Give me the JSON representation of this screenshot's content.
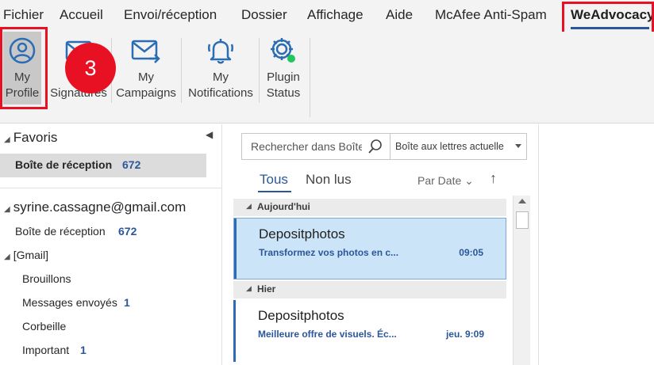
{
  "menu": {
    "tabs": [
      "Fichier",
      "Accueil",
      "Envoi/réception",
      "Dossier",
      "Affichage",
      "Aide",
      "McAfee Anti-Spam",
      "WeAdvocacy"
    ],
    "active": "WeAdvocacy"
  },
  "ribbon": {
    "my_profile": [
      "My",
      "Profile"
    ],
    "signatures": [
      "Signatures"
    ],
    "my_campaigns": [
      "My",
      "Campaigns"
    ],
    "my_notifications": [
      "My",
      "Notifications"
    ],
    "plugin_status": [
      "Plugin",
      "Status"
    ],
    "step_badge": "3",
    "plugin_status_color": "#22c55e",
    "accent": "#2b6cb3",
    "highlight": "#e81123"
  },
  "folders": {
    "favorites_title": "Favoris",
    "fav_inbox": {
      "label": "Boîte de réception",
      "count": "672"
    },
    "account": "syrine.cassagne@gmail.com",
    "items": [
      {
        "label": "Boîte de réception",
        "count": "672"
      },
      {
        "label": "[Gmail]",
        "count": ""
      },
      {
        "label": "Brouillons",
        "count": ""
      },
      {
        "label": "Messages envoyés",
        "count": "1"
      },
      {
        "label": "Corbeille",
        "count": ""
      },
      {
        "label": "Important",
        "count": "1"
      }
    ]
  },
  "list": {
    "search_placeholder": "Rechercher dans Boîte",
    "search_scope": "Boîte aux lettres actuelle",
    "filter_all": "Tous",
    "filter_unread": "Non lus",
    "sort_label": "Par Date",
    "groups": [
      {
        "header": "Aujourd'hui",
        "from": "Depositphotos",
        "subject": "Transformez vos photos en c...",
        "time": "09:05",
        "selected": true
      },
      {
        "header": "Hier",
        "from": "Depositphotos",
        "subject": "Meilleure offre de visuels. Éc...",
        "time": "jeu. 9:09",
        "selected": false
      }
    ]
  }
}
